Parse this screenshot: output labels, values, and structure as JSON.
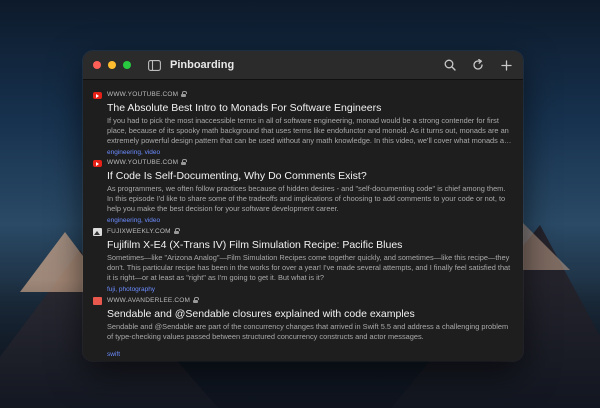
{
  "window": {
    "title": "Pinboarding"
  },
  "icons": {
    "close": "close-icon",
    "minimize": "minimize-icon",
    "zoom": "zoom-icon",
    "sidebar": "sidebar-toggle-icon",
    "search": "search-icon",
    "refresh": "refresh-icon",
    "add": "add-icon",
    "lock": "lock-icon"
  },
  "colors": {
    "tag_link": "#6b8cff",
    "window_bg": "#1e1e1e",
    "titlebar_bg": "#2b2b2b"
  },
  "bookmarks": [
    {
      "favicon": "youtube-favicon",
      "domain": "WWW.YOUTUBE.COM",
      "title": "The Absolute Best Intro to Monads For Software Engineers",
      "description": "If you had to pick the most inaccessible terms in all of software engineering, monad would be a strong contender for first place, because of its spooky math background that uses terms like endofunctor and monoid. As it turns out, monads are an extremely powerful design pattern that can be used without any math knowledge. In this video, we'll cover what monads are, how to use them, and why.",
      "tags": "engineering, video"
    },
    {
      "favicon": "youtube-favicon",
      "domain": "WWW.YOUTUBE.COM",
      "title": "If Code Is Self-Documenting, Why Do Comments Exist?",
      "description": "As programmers, we often follow practices because of hidden desires - and \"self-documenting code\" is chief among them. In this episode I'd like to share some of the tradeoffs and implications of choosing to add comments to your code or not, to help you make the best decision for your software development career.",
      "tags": "engineering, video"
    },
    {
      "favicon": "fujixweekly-favicon",
      "domain": "FUJIXWEEKLY.COM",
      "title": "Fujifilm X-E4 (X-Trans IV) Film Simulation Recipe: Pacific Blues",
      "description": "Sometimes—like \"Arizona Analog\"—Film Simulation Recipes come together quickly, and sometimes—like this recipe—they don't. This particular recipe has been in the works for over a year! I've made several attempts, and I finally feel satisfied that it is right—or at least as \"right\" as I'm going to get it. But what is it?",
      "tags": "fuji, photography"
    },
    {
      "favicon": "avanderlee-favicon",
      "domain": "WWW.AVANDERLEE.COM",
      "title": "Sendable and @Sendable closures explained with code examples",
      "description": "Sendable and @Sendable are part of the concurrency changes that arrived in Swift 5.5 and address a challenging problem of type-checking values passed between structured concurrency constructs and actor messages.",
      "tags": "swift"
    }
  ]
}
